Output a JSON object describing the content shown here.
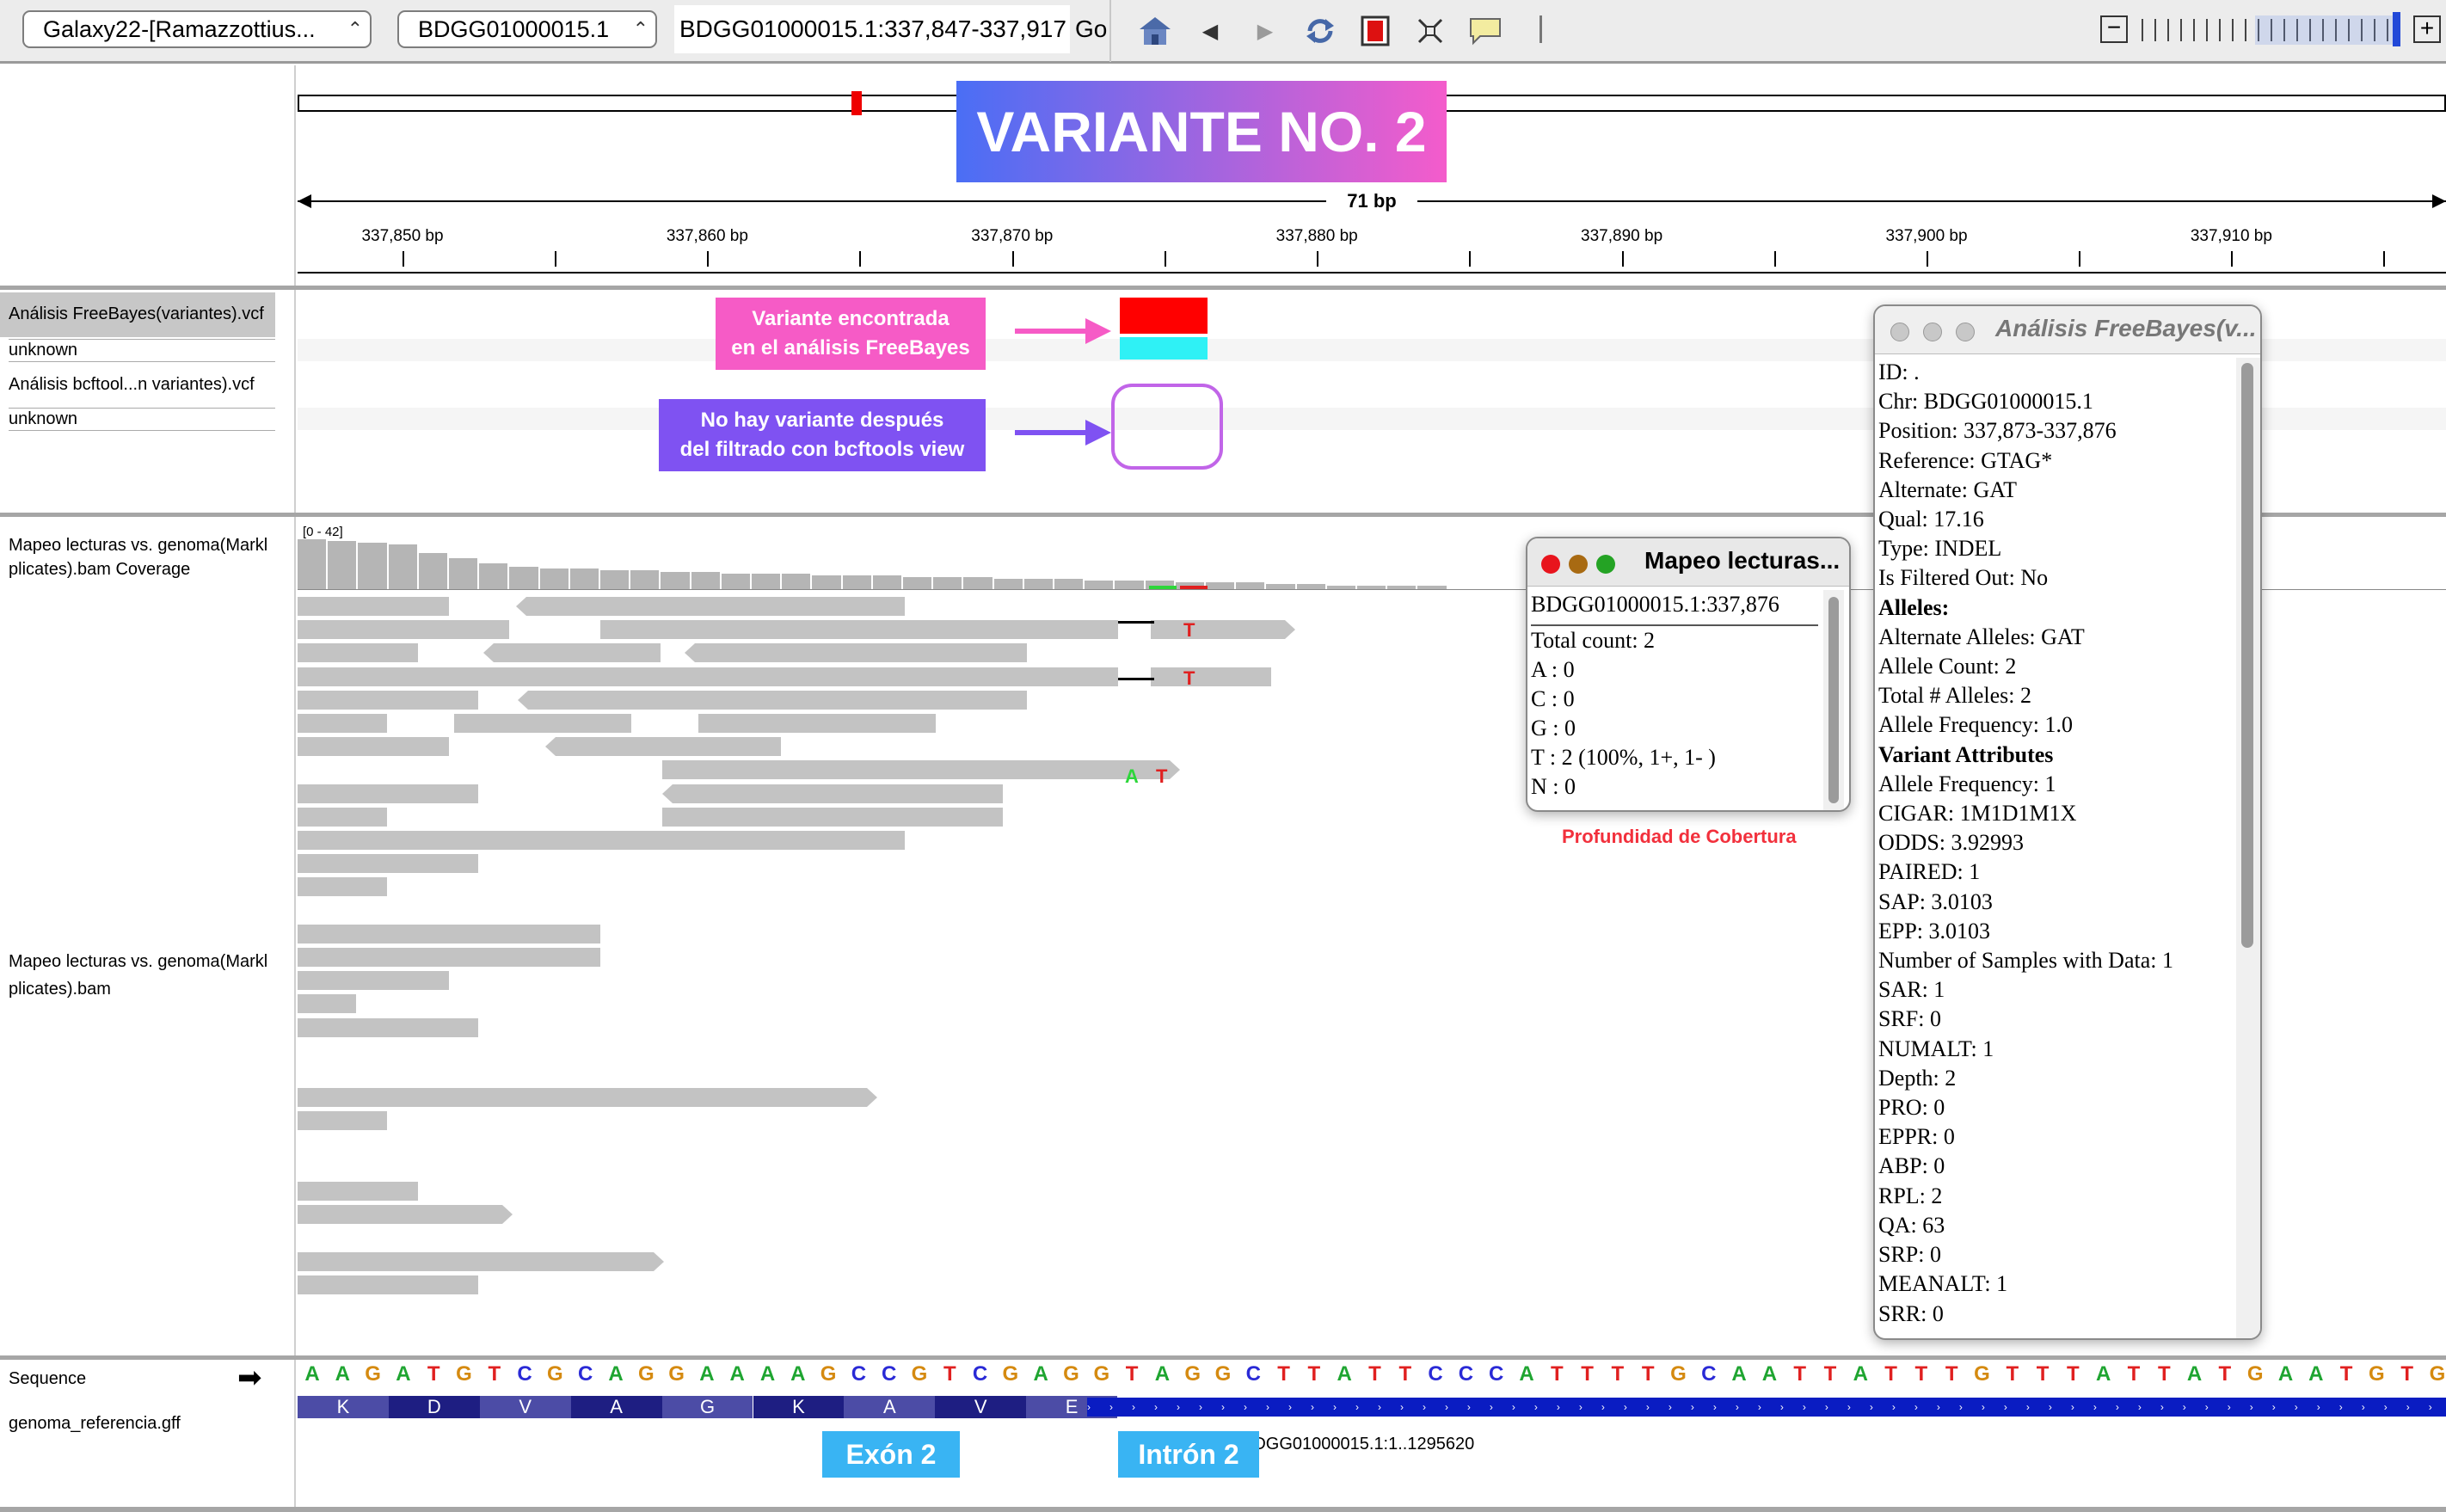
{
  "toolbar": {
    "genome": "Galaxy22-[Ramazzottius...",
    "chromosome": "BDGG01000015.1",
    "locus": "BDGG01000015.1:337,847-337,917",
    "go": "Go"
  },
  "banner": "VARIANTE NO. 2",
  "ruler": {
    "span": "71 bp",
    "ticks": [
      "337,850 bp",
      "337,860 bp",
      "337,870 bp",
      "337,880 bp",
      "337,890 bp",
      "337,900 bp",
      "337,910 bp"
    ]
  },
  "tracks": {
    "freebayes": "Análisis FreeBayes(variantes).vcf",
    "unknown1": "unknown",
    "bcftools": "Análisis bcftool...n variantes).vcf",
    "unknown2": "unknown",
    "coverage_line1": "Mapeo lecturas vs. genoma(Markl",
    "coverage_line2": "plicates).bam Coverage",
    "coverage_range": "[0 - 42]",
    "bam_line1": "Mapeo lecturas vs. genoma(Markl",
    "bam_line2": "plicates).bam",
    "sequence": "Sequence",
    "gff": "genoma_referencia.gff"
  },
  "annotations": {
    "found_line1": "Variante encontrada",
    "found_line2": "en el análisis FreeBayes",
    "none_line1": "No hay variante después",
    "none_line2": "del filtrado con bcftools view",
    "depth_caption": "Profundidad de Cobertura",
    "exon": "Exón 2",
    "intron": "Intrón 2",
    "feature_name": "BDGG01000015.1:1..1295620"
  },
  "mismatches": {
    "t1": "T",
    "t2": "T",
    "a": "A",
    "t3": "T"
  },
  "sequence": "AAGATGTCGCAGGAAAAGCCGTCGAGGTAGGCTTATTCCCATTTTGCAATTATTTGTTTATTATGAATGTG",
  "amino_acids": [
    "K",
    "D",
    "V",
    "A",
    "G",
    "K",
    "A",
    "V",
    "E"
  ],
  "colors": {
    "A": "#1fa531",
    "C": "#2a2ad6",
    "G": "#d58a10",
    "T": "#e02020",
    "banner_start": "#4a6ef5",
    "banner_end": "#f45ccb"
  },
  "coverage_popup": {
    "title": "Mapeo lecturas...",
    "lines": [
      "BDGG01000015.1:337,876",
      "Total count: 2",
      "A : 0",
      "C : 0",
      "G : 0",
      "T : 2 (100%, 1+, 1- )",
      "N : 0"
    ]
  },
  "freebayes_popup": {
    "title": "Análisis FreeBayes(v...",
    "lines": [
      {
        "t": "ID: .",
        "b": false
      },
      {
        "t": "Chr: BDGG01000015.1",
        "b": false
      },
      {
        "t": "Position: 337,873-337,876",
        "b": false
      },
      {
        "t": "Reference: GTAG*",
        "b": false
      },
      {
        "t": "Alternate: GAT",
        "b": false
      },
      {
        "t": "Qual: 17.16",
        "b": false
      },
      {
        "t": "Type: INDEL",
        "b": false
      },
      {
        "t": "Is Filtered Out: No",
        "b": false
      },
      {
        "t": "Alleles:",
        "b": true
      },
      {
        "t": "Alternate Alleles: GAT",
        "b": false
      },
      {
        "t": "Allele Count: 2",
        "b": false
      },
      {
        "t": "Total # Alleles: 2",
        "b": false
      },
      {
        "t": "Allele Frequency: 1.0",
        "b": false
      },
      {
        "t": "Variant Attributes",
        "b": true
      },
      {
        "t": "Allele Frequency: 1",
        "b": false
      },
      {
        "t": "CIGAR: 1M1D1M1X",
        "b": false
      },
      {
        "t": "ODDS: 3.92993",
        "b": false
      },
      {
        "t": "PAIRED: 1",
        "b": false
      },
      {
        "t": "SAP: 3.0103",
        "b": false
      },
      {
        "t": "EPP: 3.0103",
        "b": false
      },
      {
        "t": "Number of Samples with Data: 1",
        "b": false
      },
      {
        "t": "SAR: 1",
        "b": false
      },
      {
        "t": "SRF: 0",
        "b": false
      },
      {
        "t": "NUMALT: 1",
        "b": false
      },
      {
        "t": "Depth: 2",
        "b": false
      },
      {
        "t": "PRO: 0",
        "b": false
      },
      {
        "t": "EPPR: 0",
        "b": false
      },
      {
        "t": "ABP: 0",
        "b": false
      },
      {
        "t": "RPL: 2",
        "b": false
      },
      {
        "t": "QA: 63",
        "b": false
      },
      {
        "t": "SRP: 0",
        "b": false
      },
      {
        "t": "MEANALT: 1",
        "b": false
      },
      {
        "t": "SRR: 0",
        "b": false
      }
    ]
  }
}
